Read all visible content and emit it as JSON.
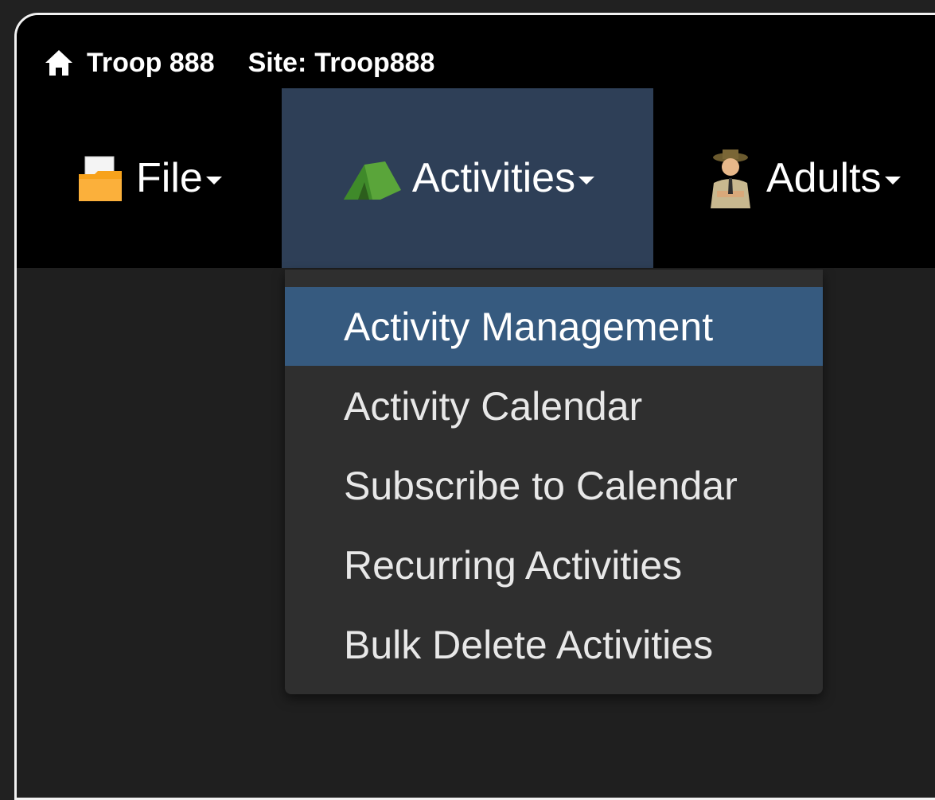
{
  "header": {
    "home_label": "Troop 888",
    "site_prefix": "Site:",
    "site_name": "Troop888"
  },
  "menu": {
    "file": {
      "label": "File",
      "icon": "folder-icon"
    },
    "activities": {
      "label": "Activities",
      "icon": "tent-icon"
    },
    "adults": {
      "label": "Adults",
      "icon": "scout-leader-icon"
    }
  },
  "dropdown": {
    "items": [
      {
        "label": "Activity Management"
      },
      {
        "label": "Activity Calendar"
      },
      {
        "label": "Subscribe to Calendar"
      },
      {
        "label": "Recurring Activities"
      },
      {
        "label": "Bulk Delete Activities"
      }
    ]
  },
  "colors": {
    "page_bg": "#212121",
    "navbar_bg": "#000000",
    "active_menu_bg": "#2e3f57",
    "dropdown_bg": "#2f2f2f",
    "dropdown_active_bg": "#365a7f"
  }
}
